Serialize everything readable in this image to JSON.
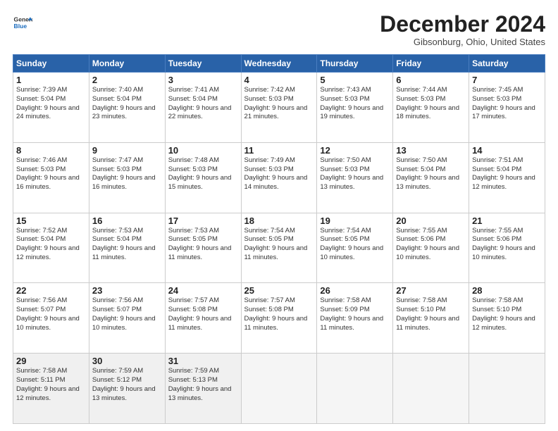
{
  "header": {
    "logo_line1": "General",
    "logo_line2": "Blue",
    "month": "December 2024",
    "location": "Gibsonburg, Ohio, United States"
  },
  "weekdays": [
    "Sunday",
    "Monday",
    "Tuesday",
    "Wednesday",
    "Thursday",
    "Friday",
    "Saturday"
  ],
  "weeks": [
    [
      {
        "day": "1",
        "rise": "Sunrise: 7:39 AM",
        "set": "Sunset: 5:04 PM",
        "light": "Daylight: 9 hours and 24 minutes."
      },
      {
        "day": "2",
        "rise": "Sunrise: 7:40 AM",
        "set": "Sunset: 5:04 PM",
        "light": "Daylight: 9 hours and 23 minutes."
      },
      {
        "day": "3",
        "rise": "Sunrise: 7:41 AM",
        "set": "Sunset: 5:04 PM",
        "light": "Daylight: 9 hours and 22 minutes."
      },
      {
        "day": "4",
        "rise": "Sunrise: 7:42 AM",
        "set": "Sunset: 5:03 PM",
        "light": "Daylight: 9 hours and 21 minutes."
      },
      {
        "day": "5",
        "rise": "Sunrise: 7:43 AM",
        "set": "Sunset: 5:03 PM",
        "light": "Daylight: 9 hours and 19 minutes."
      },
      {
        "day": "6",
        "rise": "Sunrise: 7:44 AM",
        "set": "Sunset: 5:03 PM",
        "light": "Daylight: 9 hours and 18 minutes."
      },
      {
        "day": "7",
        "rise": "Sunrise: 7:45 AM",
        "set": "Sunset: 5:03 PM",
        "light": "Daylight: 9 hours and 17 minutes."
      }
    ],
    [
      {
        "day": "8",
        "rise": "Sunrise: 7:46 AM",
        "set": "Sunset: 5:03 PM",
        "light": "Daylight: 9 hours and 16 minutes."
      },
      {
        "day": "9",
        "rise": "Sunrise: 7:47 AM",
        "set": "Sunset: 5:03 PM",
        "light": "Daylight: 9 hours and 16 minutes."
      },
      {
        "day": "10",
        "rise": "Sunrise: 7:48 AM",
        "set": "Sunset: 5:03 PM",
        "light": "Daylight: 9 hours and 15 minutes."
      },
      {
        "day": "11",
        "rise": "Sunrise: 7:49 AM",
        "set": "Sunset: 5:03 PM",
        "light": "Daylight: 9 hours and 14 minutes."
      },
      {
        "day": "12",
        "rise": "Sunrise: 7:50 AM",
        "set": "Sunset: 5:03 PM",
        "light": "Daylight: 9 hours and 13 minutes."
      },
      {
        "day": "13",
        "rise": "Sunrise: 7:50 AM",
        "set": "Sunset: 5:04 PM",
        "light": "Daylight: 9 hours and 13 minutes."
      },
      {
        "day": "14",
        "rise": "Sunrise: 7:51 AM",
        "set": "Sunset: 5:04 PM",
        "light": "Daylight: 9 hours and 12 minutes."
      }
    ],
    [
      {
        "day": "15",
        "rise": "Sunrise: 7:52 AM",
        "set": "Sunset: 5:04 PM",
        "light": "Daylight: 9 hours and 12 minutes."
      },
      {
        "day": "16",
        "rise": "Sunrise: 7:53 AM",
        "set": "Sunset: 5:04 PM",
        "light": "Daylight: 9 hours and 11 minutes."
      },
      {
        "day": "17",
        "rise": "Sunrise: 7:53 AM",
        "set": "Sunset: 5:05 PM",
        "light": "Daylight: 9 hours and 11 minutes."
      },
      {
        "day": "18",
        "rise": "Sunrise: 7:54 AM",
        "set": "Sunset: 5:05 PM",
        "light": "Daylight: 9 hours and 11 minutes."
      },
      {
        "day": "19",
        "rise": "Sunrise: 7:54 AM",
        "set": "Sunset: 5:05 PM",
        "light": "Daylight: 9 hours and 10 minutes."
      },
      {
        "day": "20",
        "rise": "Sunrise: 7:55 AM",
        "set": "Sunset: 5:06 PM",
        "light": "Daylight: 9 hours and 10 minutes."
      },
      {
        "day": "21",
        "rise": "Sunrise: 7:55 AM",
        "set": "Sunset: 5:06 PM",
        "light": "Daylight: 9 hours and 10 minutes."
      }
    ],
    [
      {
        "day": "22",
        "rise": "Sunrise: 7:56 AM",
        "set": "Sunset: 5:07 PM",
        "light": "Daylight: 9 hours and 10 minutes."
      },
      {
        "day": "23",
        "rise": "Sunrise: 7:56 AM",
        "set": "Sunset: 5:07 PM",
        "light": "Daylight: 9 hours and 10 minutes."
      },
      {
        "day": "24",
        "rise": "Sunrise: 7:57 AM",
        "set": "Sunset: 5:08 PM",
        "light": "Daylight: 9 hours and 11 minutes."
      },
      {
        "day": "25",
        "rise": "Sunrise: 7:57 AM",
        "set": "Sunset: 5:08 PM",
        "light": "Daylight: 9 hours and 11 minutes."
      },
      {
        "day": "26",
        "rise": "Sunrise: 7:58 AM",
        "set": "Sunset: 5:09 PM",
        "light": "Daylight: 9 hours and 11 minutes."
      },
      {
        "day": "27",
        "rise": "Sunrise: 7:58 AM",
        "set": "Sunset: 5:10 PM",
        "light": "Daylight: 9 hours and 11 minutes."
      },
      {
        "day": "28",
        "rise": "Sunrise: 7:58 AM",
        "set": "Sunset: 5:10 PM",
        "light": "Daylight: 9 hours and 12 minutes."
      }
    ],
    [
      {
        "day": "29",
        "rise": "Sunrise: 7:58 AM",
        "set": "Sunset: 5:11 PM",
        "light": "Daylight: 9 hours and 12 minutes."
      },
      {
        "day": "30",
        "rise": "Sunrise: 7:59 AM",
        "set": "Sunset: 5:12 PM",
        "light": "Daylight: 9 hours and 13 minutes."
      },
      {
        "day": "31",
        "rise": "Sunrise: 7:59 AM",
        "set": "Sunset: 5:13 PM",
        "light": "Daylight: 9 hours and 13 minutes."
      },
      null,
      null,
      null,
      null
    ]
  ]
}
